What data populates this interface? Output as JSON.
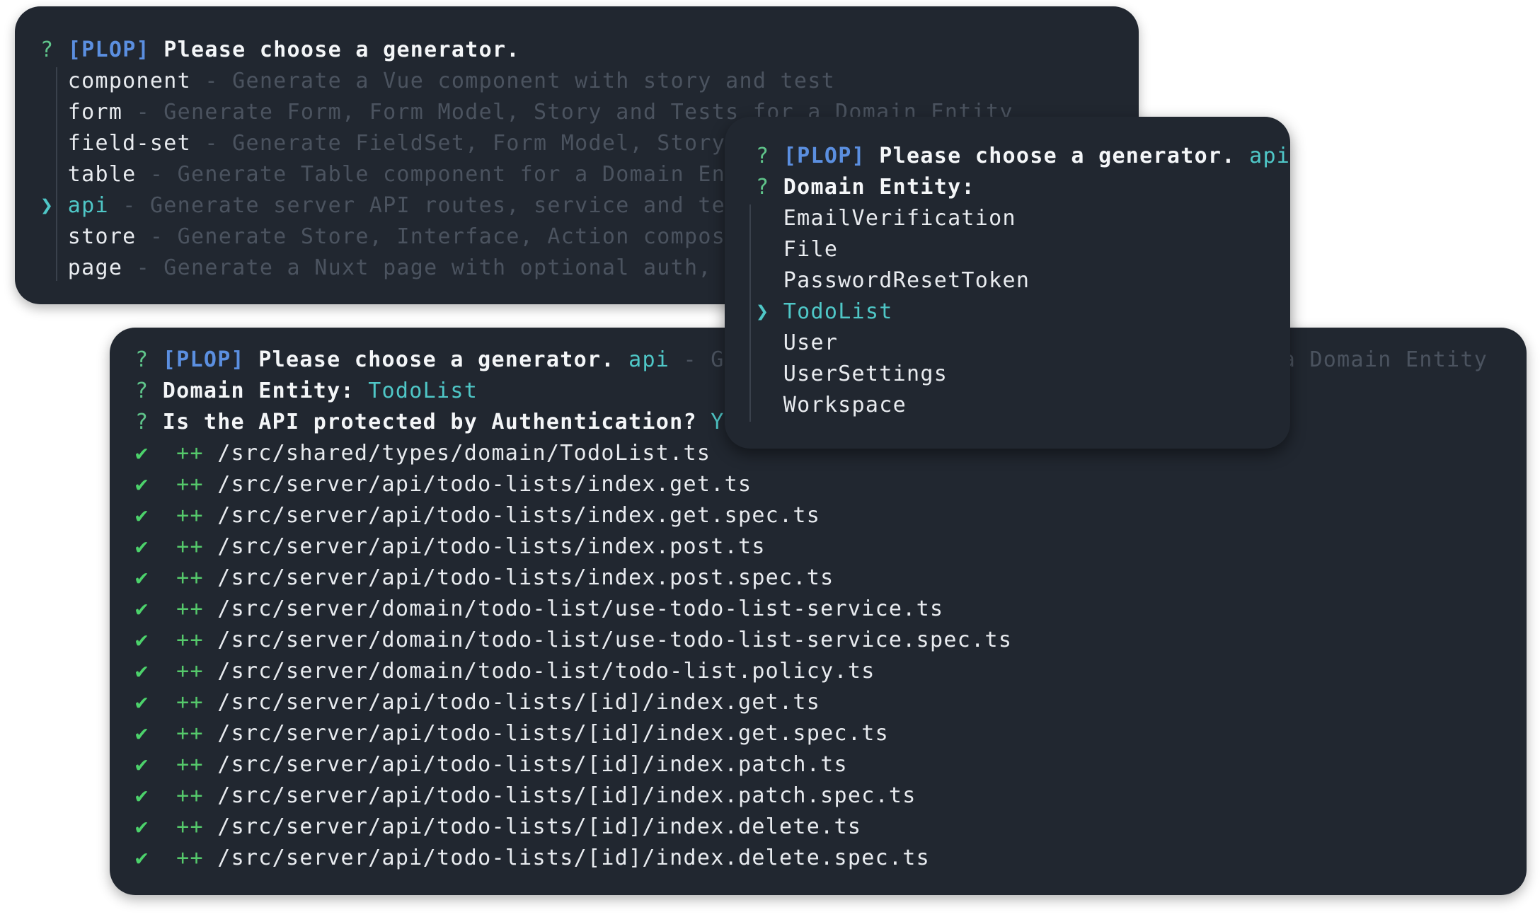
{
  "panel1": {
    "prompt": {
      "mark": "?",
      "tag": "[PLOP]",
      "question": "Please choose a generator."
    },
    "pointer": "❯",
    "generators": [
      {
        "name": "component",
        "desc": "- Generate a Vue component with story and test",
        "selected": false
      },
      {
        "name": "form",
        "desc": "- Generate Form, Form Model, Story and Tests for a Domain Entity",
        "selected": false
      },
      {
        "name": "field-set",
        "desc": "- Generate FieldSet, Form Model, Story and Tests for a Domain Entity",
        "selected": false
      },
      {
        "name": "table",
        "desc": "- Generate Table component for a Domain Entity",
        "selected": false
      },
      {
        "name": "api",
        "desc": "- Generate server API routes, service and tests",
        "selected": true
      },
      {
        "name": "store",
        "desc": "- Generate Store, Interface, Action composables",
        "selected": false
      },
      {
        "name": "page",
        "desc": "- Generate a Nuxt page with optional auth, layout",
        "selected": false
      }
    ]
  },
  "panel2": {
    "prompt": {
      "mark": "?",
      "tag": "[PLOP]",
      "question": "Please choose a generator.",
      "answer": "api"
    },
    "entity_prompt": {
      "mark": "?",
      "question": "Domain Entity:"
    },
    "pointer": "❯",
    "entities": [
      {
        "name": "EmailVerification",
        "selected": false
      },
      {
        "name": "File",
        "selected": false
      },
      {
        "name": "PasswordResetToken",
        "selected": false
      },
      {
        "name": "TodoList",
        "selected": true
      },
      {
        "name": "User",
        "selected": false
      },
      {
        "name": "UserSettings",
        "selected": false
      },
      {
        "name": "Workspace",
        "selected": false
      }
    ]
  },
  "panel3": {
    "prompt": {
      "mark": "?",
      "tag": "[PLOP]",
      "question": "Please choose a generator.",
      "answer": "api",
      "desc_head": "- Gene",
      "desc_tail": "r a Domain Entity"
    },
    "entity": {
      "mark": "?",
      "question": "Domain Entity:",
      "answer": "TodoList"
    },
    "auth": {
      "mark": "?",
      "question": "Is the API protected by Authentication?",
      "answer": "Yes"
    },
    "check_mark": "✔",
    "added_marker": "++",
    "files": [
      "/src/shared/types/domain/TodoList.ts",
      "/src/server/api/todo-lists/index.get.ts",
      "/src/server/api/todo-lists/index.get.spec.ts",
      "/src/server/api/todo-lists/index.post.ts",
      "/src/server/api/todo-lists/index.post.spec.ts",
      "/src/server/domain/todo-list/use-todo-list-service.ts",
      "/src/server/domain/todo-list/use-todo-list-service.spec.ts",
      "/src/server/domain/todo-list/todo-list.policy.ts",
      "/src/server/api/todo-lists/[id]/index.get.ts",
      "/src/server/api/todo-lists/[id]/index.get.spec.ts",
      "/src/server/api/todo-lists/[id]/index.patch.ts",
      "/src/server/api/todo-lists/[id]/index.patch.spec.ts",
      "/src/server/api/todo-lists/[id]/index.delete.ts",
      "/src/server/api/todo-lists/[id]/index.delete.spec.ts"
    ]
  },
  "colors": {
    "panel_bg": "#212730",
    "prompt_mark": "#5fc48a",
    "plop_tag": "#5b8fe0",
    "answer": "#4fc7c7",
    "dim_desc": "#4b535f",
    "check": "#4cd26b"
  }
}
